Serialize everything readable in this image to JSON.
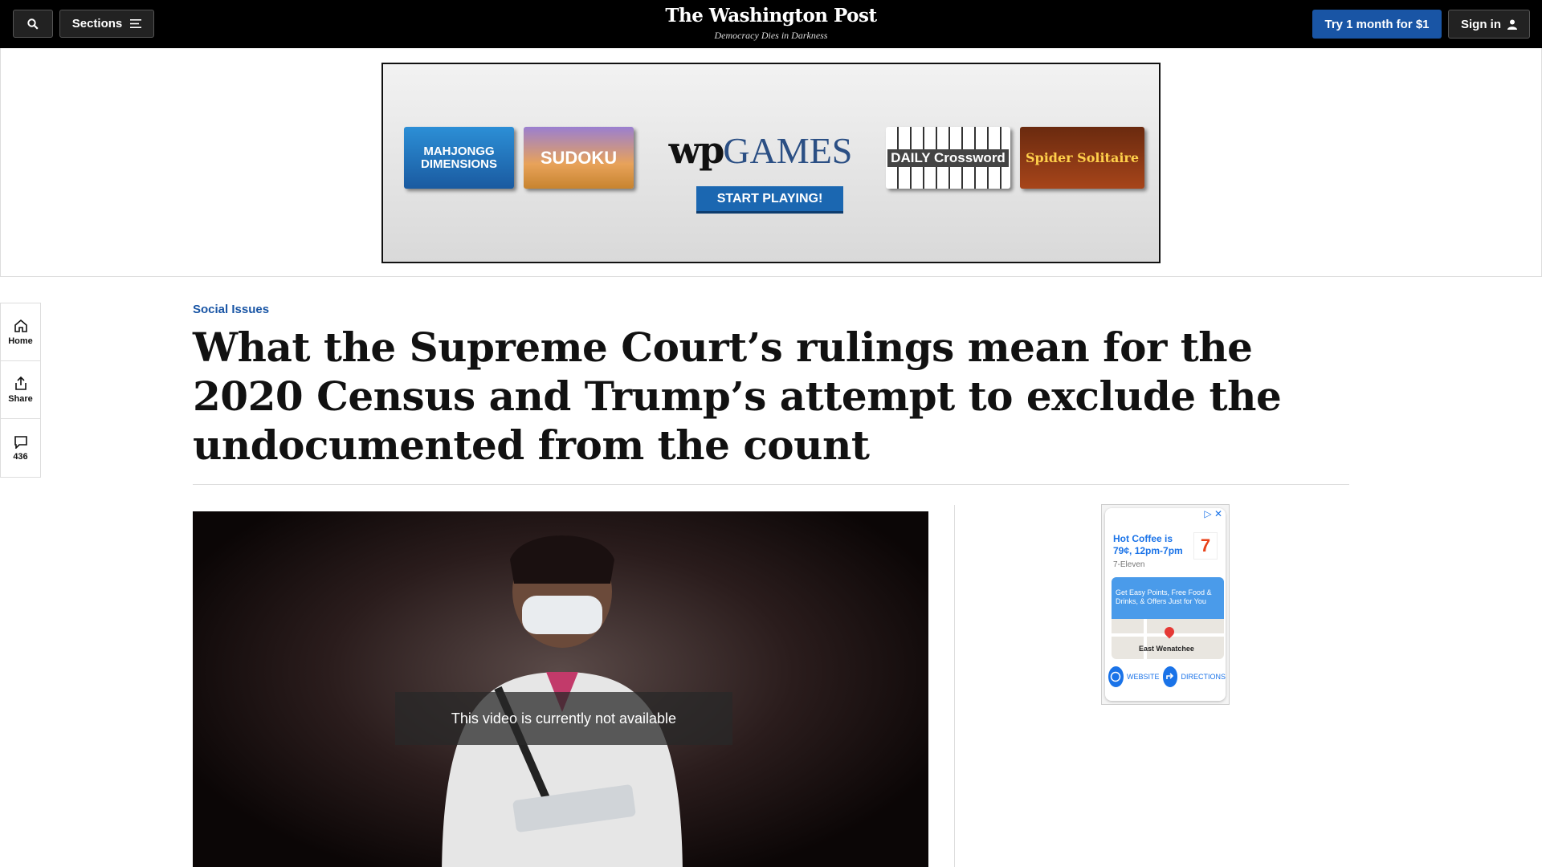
{
  "topnav": {
    "sections_label": "Sections",
    "logo": "The Washington Post",
    "tagline": "Democracy Dies in Darkness",
    "try_label": "Try 1 month for $1",
    "signin_label": "Sign in"
  },
  "ad_banner": {
    "tiles": [
      "MAHJONGG DIMENSIONS",
      "SUDOKU",
      "DAILY Crossword",
      "Spider Solitaire"
    ],
    "brand_mark": "wp",
    "brand_word": "GAMES",
    "cta": "START PLAYING!"
  },
  "left_rail": {
    "home": "Home",
    "share": "Share",
    "comments": "436"
  },
  "article": {
    "kicker": "Social Issues",
    "headline": "What the Supreme Court’s rulings mean for the 2020 Census and Trump’s attempt to exclude the undocumented from the count",
    "video_message": "This video is currently not available"
  },
  "side_ad": {
    "headline": "Hot Coffee is 79¢, 12pm-7pm",
    "brand": "7-Eleven",
    "promo": "Get Easy Points, Free Food & Drinks, & Offers Just for You",
    "place": "East Wenatchee",
    "website_label": "WEBSITE",
    "directions_label": "DIRECTIONS"
  },
  "colors": {
    "topbar": "#000000",
    "accent_blue": "#1955a5",
    "kicker_blue": "#1955a5"
  }
}
